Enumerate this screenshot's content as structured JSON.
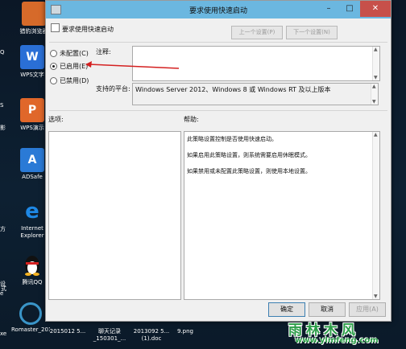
{
  "desktop": {
    "icons": [
      {
        "label": "猎豹浏览器",
        "glyph": "",
        "color": "#d66a2a"
      },
      {
        "label": "WPS文字",
        "glyph": "W",
        "color": "#2a6fd6"
      },
      {
        "label": "WPS演示",
        "glyph": "P",
        "color": "#e0672a"
      },
      {
        "label": "ADSafe",
        "glyph": "A",
        "color": "#2a7ad6"
      },
      {
        "label": "Internet Explorer",
        "glyph": "e",
        "color": "#1e88e5"
      },
      {
        "label": "腾讯QQ",
        "glyph": "Q",
        "color": "#222222"
      },
      {
        "label": "Romaster_2015...",
        "glyph": "",
        "color": "#3a95c8"
      }
    ],
    "left_edge_labels": [
      "Q",
      "S",
      "影",
      "方",
      "设",
      "e",
      "式",
      "xe"
    ],
    "bottom_files": [
      {
        "name": "Romaster_2015..."
      },
      {
        "name": "2015012 5..."
      },
      {
        "name": "聊天记录_150301_..."
      },
      {
        "name": "2013092 5...(1).doc"
      },
      {
        "name": "9.png"
      }
    ]
  },
  "dialog": {
    "title": "要求使用快速启动",
    "policy_name": "要求使用快速启动",
    "prev_setting": "上一个设置(P)",
    "next_setting": "下一个设置(N)",
    "radios": {
      "not_configured": "未配置(C)",
      "enabled": "已启用(E)",
      "disabled": "已禁用(D)",
      "selected": "enabled"
    },
    "comment_label": "注释:",
    "comment_value": "",
    "platform_label": "支持的平台:",
    "platform_value": "Windows Server 2012、Windows 8 或 Windows RT 及以上版本",
    "options_label": "选项:",
    "help_label": "帮助:",
    "help_paragraphs": [
      "此策略设置控制是否使用快速启动。",
      "如果启用此策略设置，则系统需要启用休眠模式。",
      "如果禁用或未配置此策略设置，则使用本地设置。"
    ],
    "buttons": {
      "ok": "确定",
      "cancel": "取消",
      "apply": "应用(A)"
    }
  },
  "watermark": {
    "cn": "雨林木风",
    "url": "www.ylmfeng.com"
  },
  "colors": {
    "titlebar": "#6bb7e0",
    "close_button": "#c7504a",
    "annotation_arrow": "#d42020",
    "watermark": "#2b9d48"
  }
}
